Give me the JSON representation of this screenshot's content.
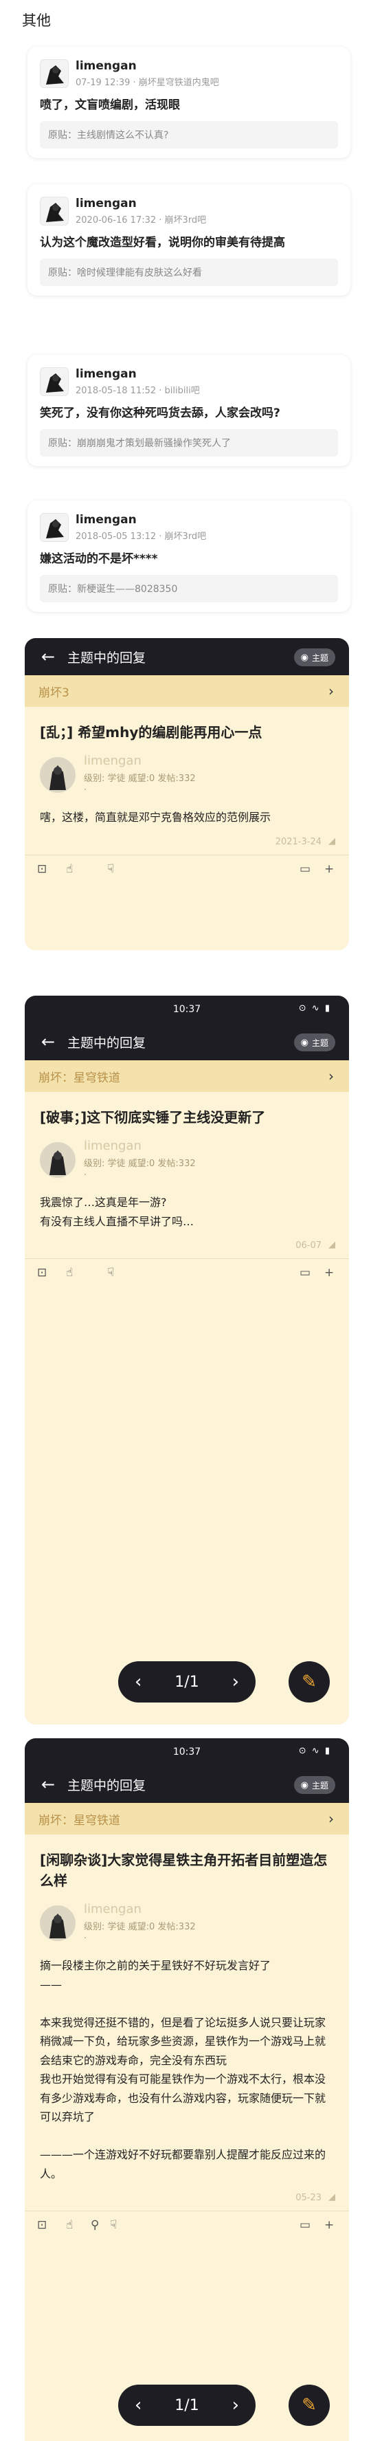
{
  "section_title": "其他",
  "replies": [
    {
      "user": "limengan",
      "sub": "07-19 12:39 · 崩坏星穹铁道内鬼吧",
      "text": "喷了，文盲喷编剧，活现眼",
      "quote_label": "原贴：",
      "quote": "主线剧情这么不认真?"
    },
    {
      "user": "limengan",
      "sub": "2020-06-16 17:32 · 崩坏3rd吧",
      "text": "认为这个魔改造型好看，说明你的审美有待提高",
      "quote_label": "原贴：",
      "quote": "啥时候理律能有皮肤这么好看"
    },
    {
      "user": "limengan",
      "sub": "2018-05-18 11:52 · bilibili吧",
      "text": "笑死了，没有你这种死吗货去舔，人家会改吗?",
      "quote_label": "原贴：",
      "quote": "崩崩崩鬼才策划最新骚操作笑死人了"
    },
    {
      "user": "limengan",
      "sub": "2018-05-05 13:12 · 崩坏3rd吧",
      "text": "嫌这活动的不是坏****",
      "quote_label": "原贴：",
      "quote": "新梗诞生——8028350"
    }
  ],
  "app": {
    "status_time": "10:37",
    "status_icons": "⊙ ∿ ▮",
    "back_icon": "←",
    "header_title": "主题中的回复",
    "badge_label": "主题",
    "pager_text": "1/1",
    "pager_prev": "‹",
    "pager_next": "›",
    "fab_icon": "✎",
    "author_dot": "·",
    "fin_icon": "◢"
  },
  "threads": [
    {
      "forum": "崩坏3",
      "title": "[乱；] 希望mhy的编剧能再用心一点",
      "author": "limengan",
      "stats": "级别: 学徒 威望:0 发帖:332",
      "body": "嗐，这楼，简直就是邓宁克鲁格效应的范例展示",
      "date": "2021-3-24"
    },
    {
      "forum": "崩坏：星穹铁道",
      "title": "[破事；]这下彻底实锤了主线没更新了",
      "author": "limengan",
      "stats": "级别: 学徒 威望:0 发帖:332",
      "body": "我震惊了…这真是年一游?\n有没有主线人直播不早讲了吗…",
      "date": "06-07"
    },
    {
      "forum": "崩坏：星穹铁道",
      "title": "[闲聊杂谈]大家觉得星铁主角开拓者目前塑造怎么样",
      "author": "limengan",
      "stats": "级别: 学徒 威望:0 发帖:332",
      "body": "摘一段楼主你之前的关于星铁好不好玩发言好了\n——\n\n本来我觉得还挺不错的，但是看了论坛挺多人说只要让玩家稍微减一下负，给玩家多些资源，星铁作为一个游戏马上就会结束它的游戏寿命，完全没有东西玩\n我也开始觉得有没有可能星铁作为一个游戏不太行，根本没有多少游戏寿命，也没有什么游戏内容，玩家随便玩一下就可以弃坑了\n\n———一个连游戏好不好玩都要靠别人提醒才能反应过来的人。",
      "date": "05-23"
    }
  ],
  "actions": {
    "gift": "⊡",
    "like": "☝",
    "dislike": "☟",
    "comment": "▭",
    "more": "+",
    "location": "⚲"
  }
}
